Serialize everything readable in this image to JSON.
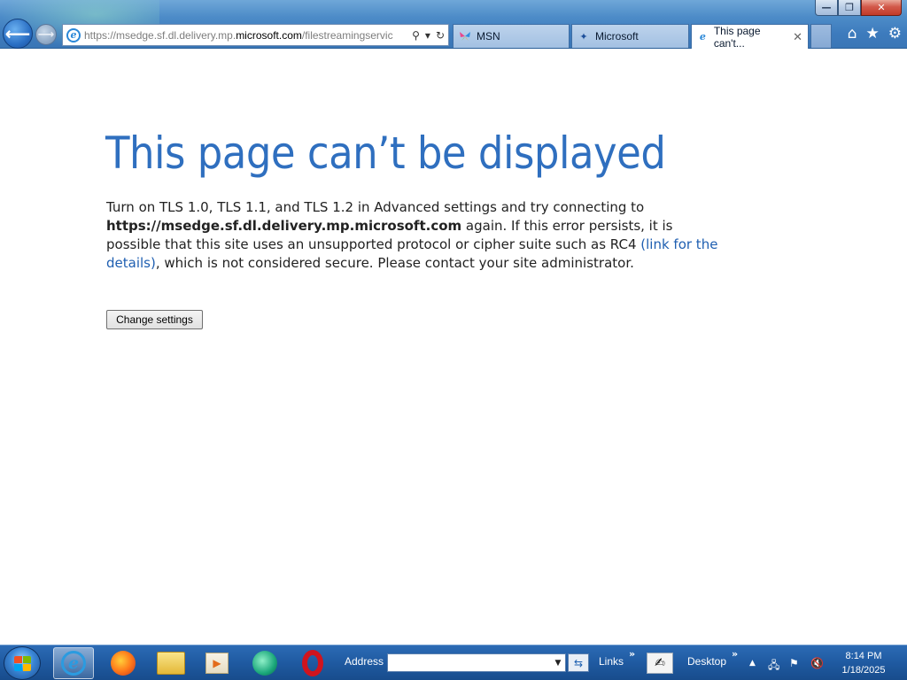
{
  "window": {
    "minimize_label": "—",
    "maximize_label": "❐",
    "close_label": "✕"
  },
  "browser": {
    "address": {
      "url_prefix": "https://msedge.sf.dl.delivery.mp.",
      "url_domain": "microsoft.com",
      "url_suffix": "/filestreamingservic",
      "search_glyph": "⚲",
      "dropdown_glyph": "▾",
      "refresh_glyph": "↻"
    },
    "tabs": [
      {
        "label": "MSN",
        "active": false
      },
      {
        "label": "Microsoft",
        "active": false
      },
      {
        "label": "This page can't...",
        "active": true,
        "close": "✕"
      }
    ],
    "toolbar_icons": [
      "home-icon",
      "favorites-icon",
      "tools-icon"
    ]
  },
  "page": {
    "heading": "This page can’t be displayed",
    "message": {
      "part1": "Turn on TLS 1.0, TLS 1.1, and TLS 1.2 in Advanced settings and try connecting to ",
      "host": "https://msedge.sf.dl.delivery.mp.microsoft.com",
      "part2": " again. If this error persists, it is possible that this site uses an unsupported protocol or cipher suite such as RC4 ",
      "link": "(link for the details)",
      "part3": ", which is not considered secure. Please contact your site administrator."
    },
    "button_label": "Change settings"
  },
  "taskbar": {
    "pinned": [
      "internet-explorer-icon",
      "firefox-icon",
      "file-explorer-icon",
      "media-player-icon",
      "app-icon",
      "opera-icon"
    ],
    "address_label": "Address",
    "address_value": "",
    "links_label": "Links",
    "desktop_label": "Desktop",
    "chevron": "»",
    "clock": {
      "time": "8:14 PM",
      "date": "1/18/2025"
    }
  }
}
